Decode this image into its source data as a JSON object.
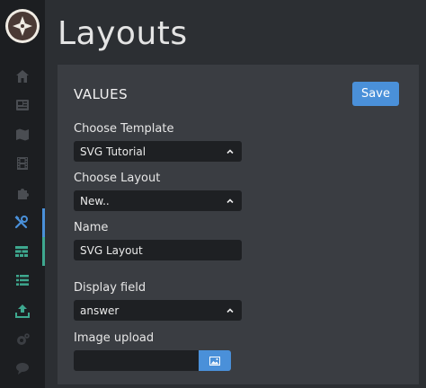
{
  "header": {
    "title": "Layouts"
  },
  "panel": {
    "title": "VALUES",
    "save_label": "Save",
    "fields": {
      "template": {
        "label": "Choose Template",
        "value": "SVG Tutorial"
      },
      "layout": {
        "label": "Choose Layout",
        "value": "New.."
      },
      "name": {
        "label": "Name",
        "value": "SVG Layout"
      },
      "display": {
        "label": "Display field",
        "value": "answer"
      },
      "image": {
        "label": "Image upload",
        "value": ""
      }
    }
  },
  "sidebar": {
    "items": [
      "home-icon",
      "newspaper-icon",
      "map-icon",
      "film-icon",
      "puzzle-icon",
      "tools-icon",
      "layout-grid-icon",
      "list-icon",
      "upload-icon",
      "gear-icon",
      "chat-icon"
    ]
  },
  "colors": {
    "accent": "#4a90d9",
    "teal": "#3ea88f",
    "sidebar": "#1c1e21",
    "panel": "#3a3d42",
    "background": "#2c2f33"
  }
}
